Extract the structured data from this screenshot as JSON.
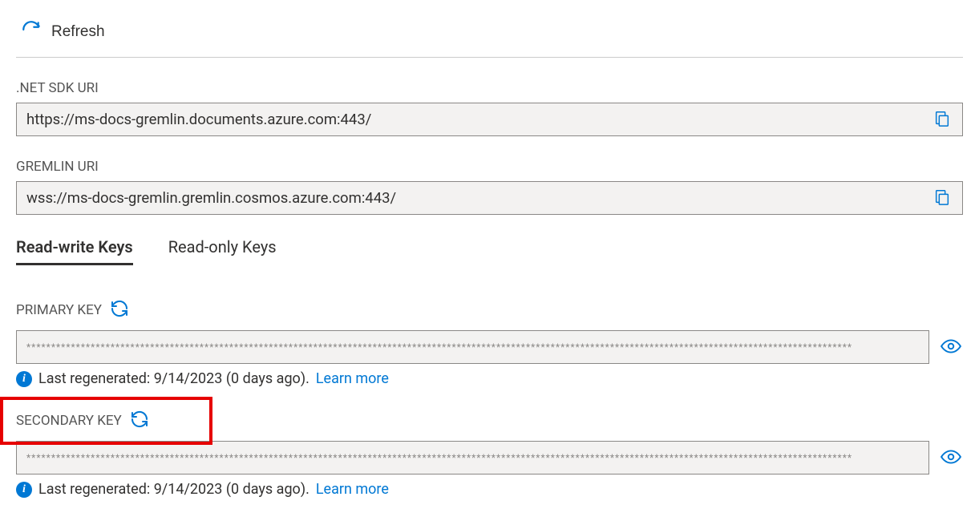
{
  "toolbar": {
    "refresh_label": "Refresh"
  },
  "net_sdk_uri": {
    "label": ".NET SDK URI",
    "value": "https://ms-docs-gremlin.documents.azure.com:443/"
  },
  "gremlin_uri": {
    "label": "GREMLIN URI",
    "value": "wss://ms-docs-gremlin.gremlin.cosmos.azure.com:443/"
  },
  "tabs": {
    "readwrite": "Read-write Keys",
    "readonly": "Read-only Keys"
  },
  "primary_key": {
    "label": "PRIMARY KEY",
    "masked": "***********************************************************************************************************************************************************************",
    "regenerated_text": "Last regenerated: 9/14/2023 (0 days ago).",
    "learn_more": "Learn more"
  },
  "secondary_key": {
    "label": "SECONDARY KEY",
    "masked": "***********************************************************************************************************************************************************************",
    "regenerated_text": "Last regenerated: 9/14/2023 (0 days ago).",
    "learn_more": "Learn more"
  }
}
